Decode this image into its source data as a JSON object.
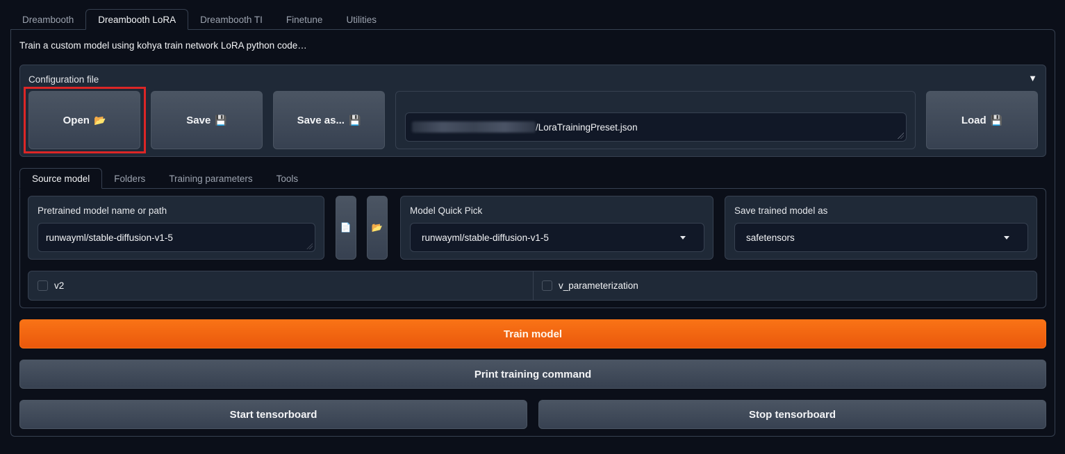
{
  "top_tabs": [
    "Dreambooth",
    "Dreambooth LoRA",
    "Dreambooth TI",
    "Finetune",
    "Utilities"
  ],
  "active_top_tab": "Dreambooth LoRA",
  "description": "Train a custom model using kohya train network LoRA python code…",
  "config": {
    "title": "Configuration file",
    "collapse_icon": "▼",
    "open_label": "Open",
    "open_icon": "📂",
    "save_label": "Save",
    "save_icon": "💾",
    "save_as_label": "Save as...",
    "save_as_icon": "💾",
    "file_path_visible": "/LoraTrainingPreset.json",
    "load_label": "Load",
    "load_icon": "💾"
  },
  "sub_tabs": [
    "Source model",
    "Folders",
    "Training parameters",
    "Tools"
  ],
  "active_sub_tab": "Source model",
  "source_model": {
    "pretrained_label": "Pretrained model name or path",
    "pretrained_value": "runwayml/stable-diffusion-v1-5",
    "file_icon": "📄",
    "folder_icon": "📂",
    "quick_pick_label": "Model Quick Pick",
    "quick_pick_value": "runwayml/stable-diffusion-v1-5",
    "save_as_label": "Save trained model as",
    "save_as_value": "safetensors",
    "v2_label": "v2",
    "v2_checked": false,
    "v_param_label": "v_parameterization",
    "v_param_checked": false
  },
  "actions": {
    "train": "Train model",
    "print_cmd": "Print training command",
    "start_tb": "Start tensorboard",
    "stop_tb": "Stop tensorboard"
  },
  "colors": {
    "background": "#0b0f19",
    "panel": "#1f2937",
    "accent": "#f97316",
    "highlight": "#dc2626"
  }
}
